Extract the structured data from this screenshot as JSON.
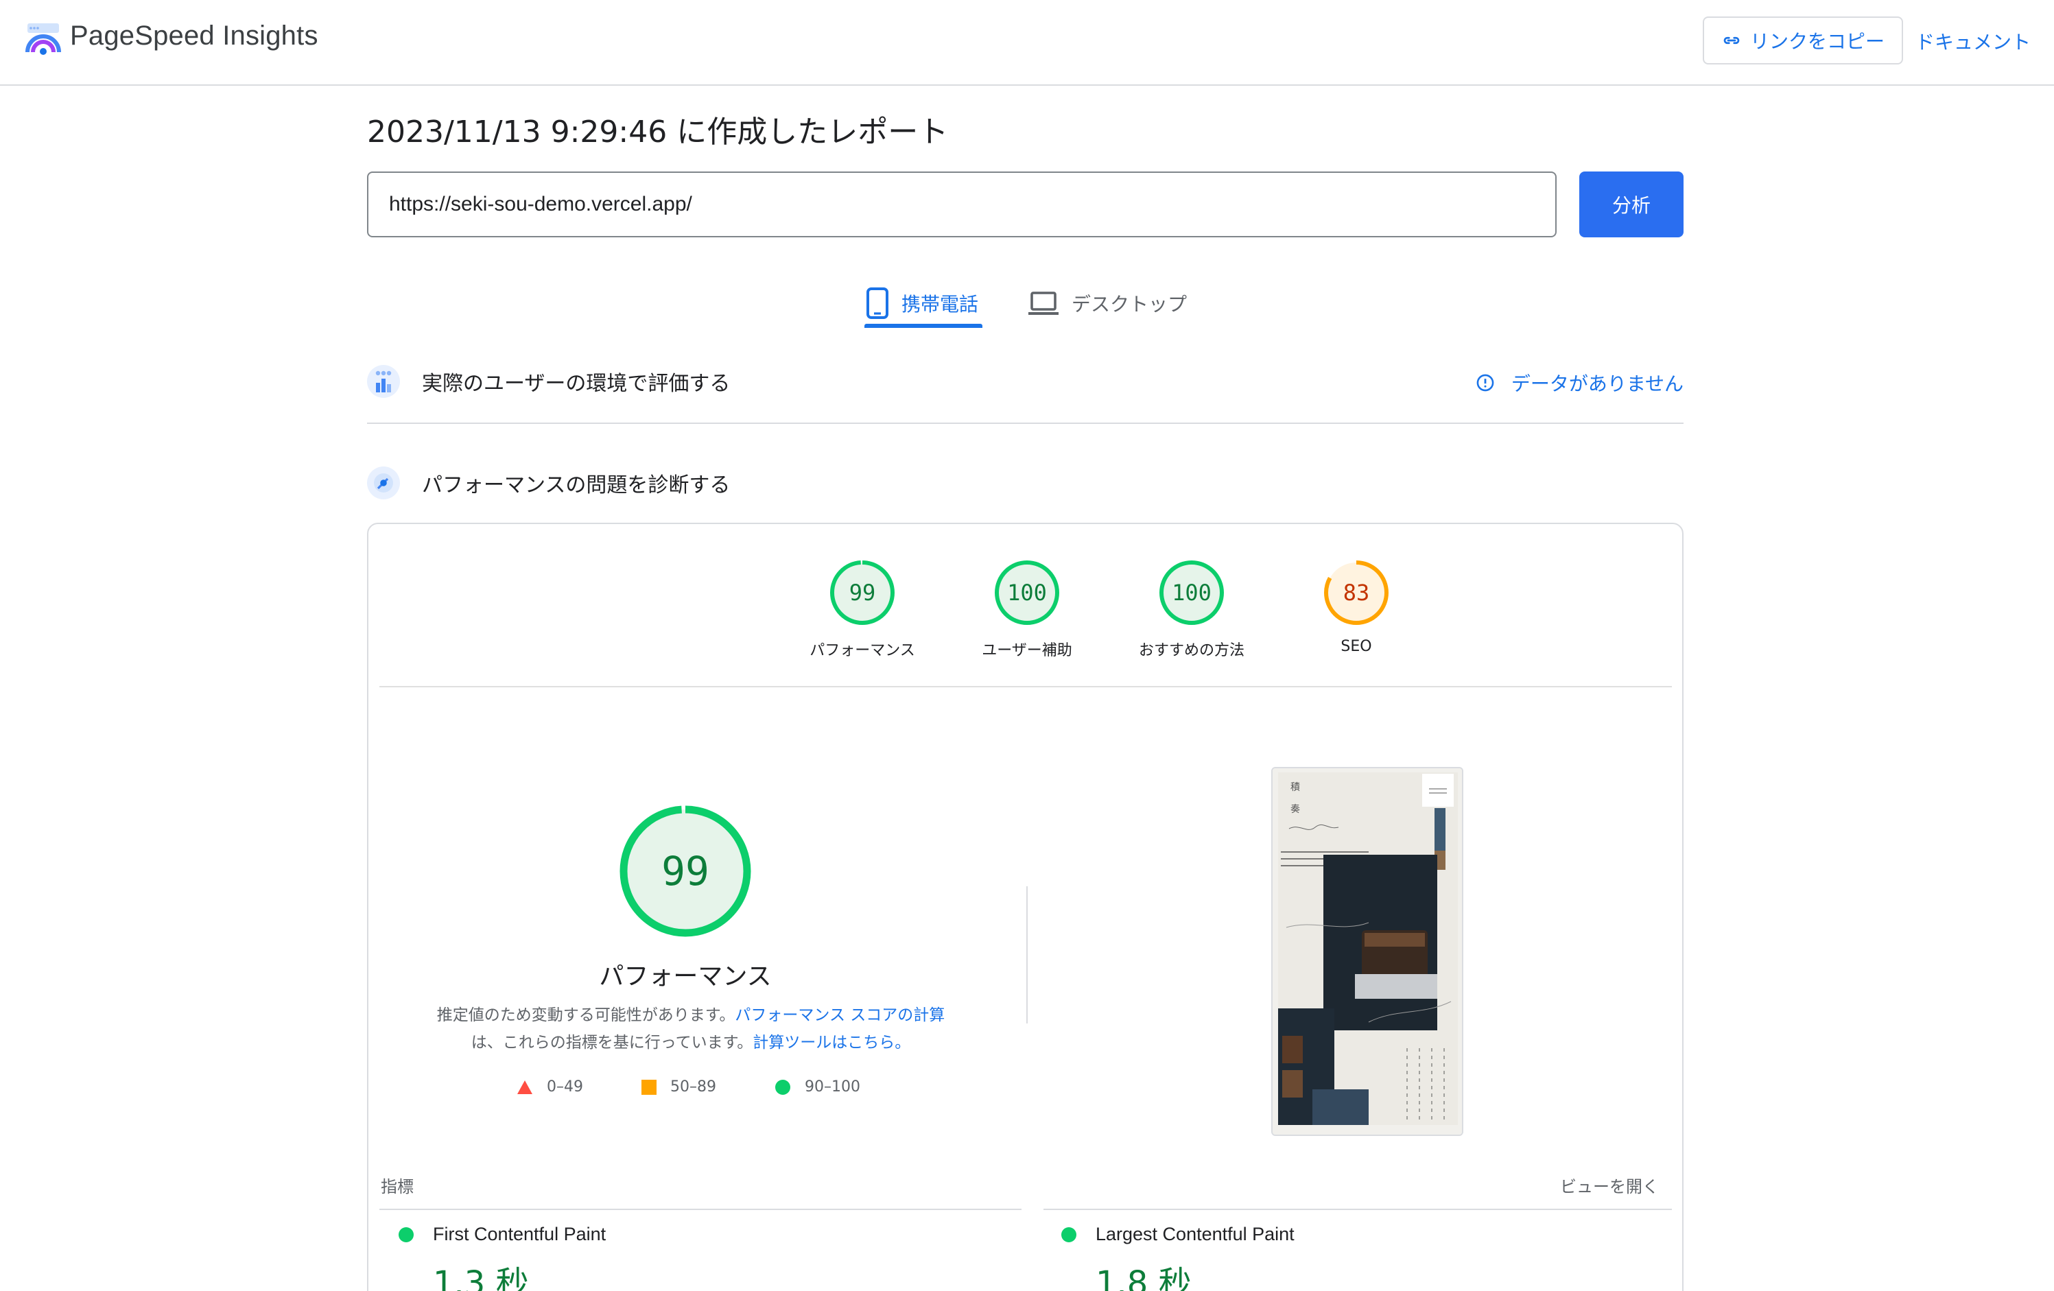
{
  "header": {
    "app_title": "PageSpeed Insights",
    "copy_link_label": "リンクをコピー",
    "docs_label": "ドキュメント"
  },
  "report": {
    "title": "2023/11/13 9:29:46 に作成したレポート",
    "url_value": "https://seki-sou-demo.vercel.app/",
    "analyze_label": "分析"
  },
  "tabs": [
    {
      "label": "携帯電話",
      "icon": "smartphone-icon",
      "active": true
    },
    {
      "label": "デスクトップ",
      "icon": "laptop-icon",
      "active": false
    }
  ],
  "field_data": {
    "label": "実際のユーザーの環境で評価する",
    "status_label": "データがありません"
  },
  "diagnose": {
    "label": "パフォーマンスの問題を診断する"
  },
  "scores": [
    {
      "label": "パフォーマンス",
      "value": "99",
      "color": "#0cce6b",
      "text_color": "#0d7d3a"
    },
    {
      "label": "ユーザー補助",
      "value": "100",
      "color": "#0cce6b",
      "text_color": "#0d7d3a"
    },
    {
      "label": "おすすめの方法",
      "value": "100",
      "color": "#0cce6b",
      "text_color": "#0d7d3a"
    },
    {
      "label": "SEO",
      "value": "83",
      "color": "#ffa400",
      "text_color": "#c33300"
    }
  ],
  "performance": {
    "score": "99",
    "title": "パフォーマンス",
    "desc_1": "推定値のため変動する可能性があります。",
    "desc_link_1": "パフォーマンス スコアの計算",
    "desc_2": "は、これらの指標を基に行っています。",
    "desc_link_2": "計算ツールはこちら。"
  },
  "legend": [
    {
      "range": "0–49",
      "shape": "triangle",
      "color": "#ff4e42"
    },
    {
      "range": "50–89",
      "shape": "square",
      "color": "#ffa400"
    },
    {
      "range": "90–100",
      "shape": "circle",
      "color": "#0cce6b"
    }
  ],
  "metrics": {
    "heading": "指標",
    "expand_label": "ビューを開く",
    "items": [
      {
        "name": "First Contentful Paint",
        "value": "1.3 秒"
      },
      {
        "name": "Largest Contentful Paint",
        "value": "1.8 秒"
      }
    ]
  },
  "colors": {
    "accent": "#1a73e8",
    "pass": "#0cce6b",
    "average": "#ffa400",
    "fail": "#ff4e42"
  }
}
